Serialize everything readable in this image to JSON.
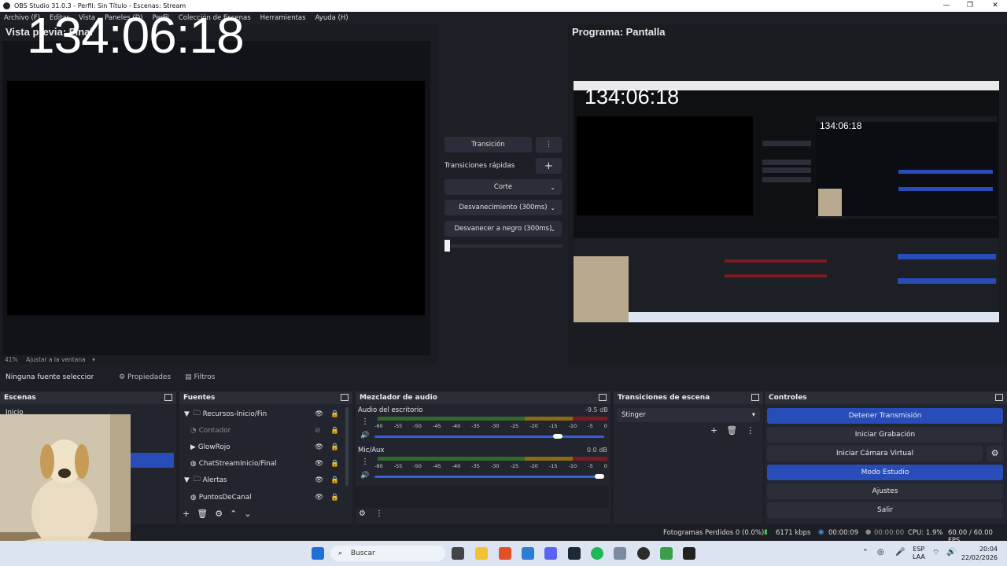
{
  "window": {
    "title": "OBS Studio 31.0.3 - Perfil: Sin Título - Escenas: Stream",
    "minimize": "—",
    "maximize": "❐",
    "close": "✕"
  },
  "menu": [
    "Archivo (F)",
    "Editar",
    "Vista",
    "Paneles (D)",
    "Perfil",
    "Colección de Escenas",
    "Herramientas",
    "Ayuda (H)"
  ],
  "preview": {
    "title": "Vista previa: Final",
    "clock": "134:06:18",
    "zoom": "41%",
    "fit": "Ajustar a la ventana"
  },
  "program": {
    "title": "Programa: Pantalla"
  },
  "transitions_center": {
    "transition": "Transición",
    "quick": "Transiciones rápidas",
    "cut": "Corte",
    "fade": "Desvanecimiento (300ms)",
    "fade_black": "Desvanecer a negro (300ms)"
  },
  "props": {
    "no_source": "Ninguna fuente seleccionada",
    "properties": "Propiedades",
    "filters": "Filtros"
  },
  "scenes": {
    "title": "Escenas",
    "items": [
      "Inicio"
    ]
  },
  "sources": {
    "title": "Fuentes",
    "items": [
      {
        "label": "Recursos-Inicio/Fin",
        "type": "folder"
      },
      {
        "label": "Contador",
        "type": "item-hidden"
      },
      {
        "label": "GlowRojo",
        "type": "item"
      },
      {
        "label": "ChatStreamInicio/Final",
        "type": "item"
      },
      {
        "label": "Alertas",
        "type": "folder"
      },
      {
        "label": "PuntosDeCanal",
        "type": "item"
      }
    ]
  },
  "mixer": {
    "title": "Mezclador de audio",
    "channels": [
      {
        "name": "Audio del escritorio",
        "db": "-9.5 dB",
        "level": 0.82
      },
      {
        "name": "Mic/Aux",
        "db": "0.0 dB",
        "level": 1.0
      }
    ],
    "scale": [
      "-60",
      "-55",
      "-50",
      "-45",
      "-40",
      "-35",
      "-30",
      "-25",
      "-20",
      "-15",
      "-10",
      "-5",
      "0"
    ]
  },
  "scene_transitions": {
    "title": "Transiciones de escena",
    "selected": "Stinger"
  },
  "controls": {
    "title": "Controles",
    "stop_stream": "Detener Transmisión",
    "start_rec": "Iniciar Grabación",
    "virtual_cam": "Iniciar Cámara Virtual",
    "studio": "Modo Estudio",
    "settings": "Ajustes",
    "exit": "Salir"
  },
  "status": {
    "dropped": "Fotogramas Perdidos 0 (0.0%)",
    "kbps": "6171 kbps",
    "live_time": "00:00:09",
    "rec_time": "00:00:00",
    "cpu": "CPU: 1.9%",
    "fps": "60.00 / 60.00 FPS"
  },
  "taskbar": {
    "search": "Buscar",
    "lang1": "ESP",
    "lang2": "LAA",
    "time": "20:04",
    "date": "22/02/2026"
  },
  "colors": {
    "accent": "#284cb8",
    "bg": "#1d1f26",
    "panel": "#22252d"
  }
}
